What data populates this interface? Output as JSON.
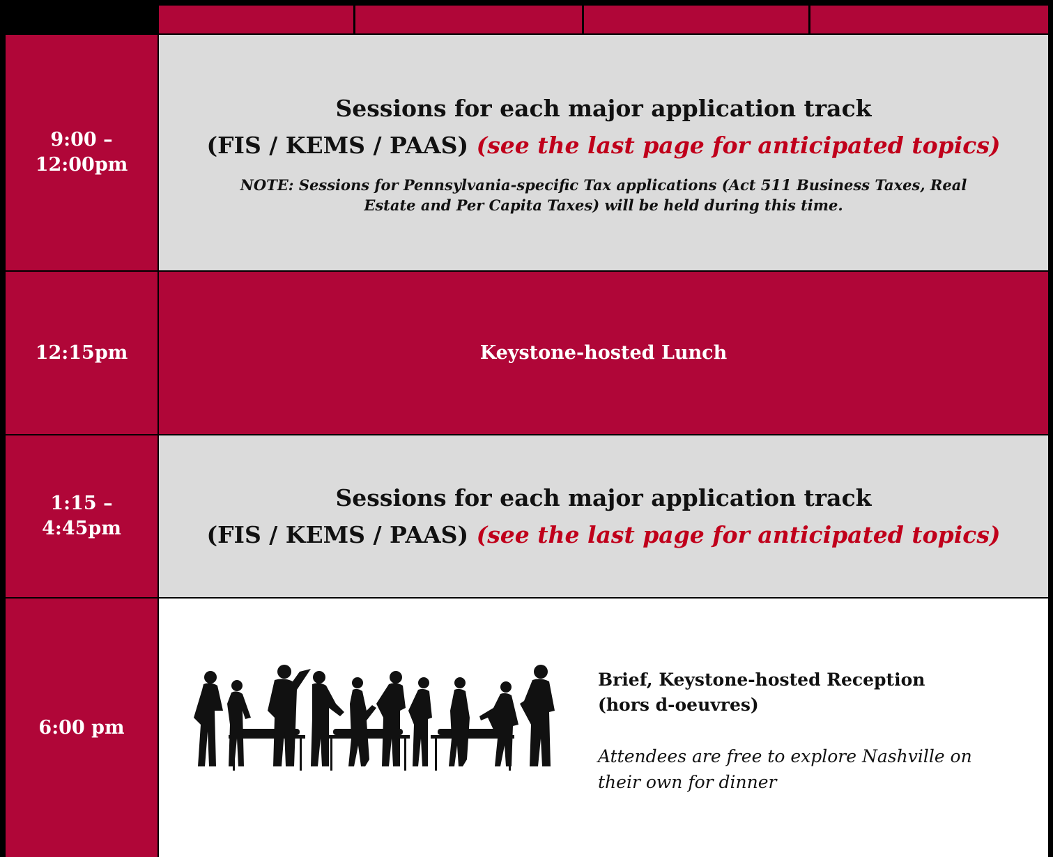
{
  "header": {
    "columns": [
      "",
      "",
      "",
      ""
    ]
  },
  "rows": [
    {
      "time_lines": [
        "9:00 –",
        "12:00pm"
      ],
      "heading_line1": "Sessions for each major application track",
      "heading_line2_prefix": "(FIS / KEMS / PAAS)",
      "heading_line2_link": "(see the last page for anticipated topics)",
      "note_line1": "NOTE: Sessions for Pennsylvania-specific Tax applications (Act 511 Business Taxes, Real",
      "note_line2": "Estate and Per Capita Taxes) will be held during this time."
    },
    {
      "time": "12:15pm",
      "event": "Keystone-hosted Lunch"
    },
    {
      "time_lines": [
        "1:15 –",
        "4:45pm"
      ],
      "heading_line1": "Sessions for each major application track",
      "heading_line2_prefix": "(FIS / KEMS / PAAS)",
      "heading_line2_link": "(see the last page for anticipated topics)"
    },
    {
      "time": "6:00 pm",
      "title_line1": "Brief, Keystone-hosted Reception",
      "title_line2": "(hors d-oeuvres)",
      "note_line1": "Attendees are free to explore Nashville on",
      "note_line2": "their own for dinner",
      "image": "party-silhouette-image"
    }
  ],
  "colors": {
    "crimson": "#b00638",
    "grey_cell": "#dbdbdb",
    "link_red": "#c0001b",
    "border": "#000000"
  }
}
